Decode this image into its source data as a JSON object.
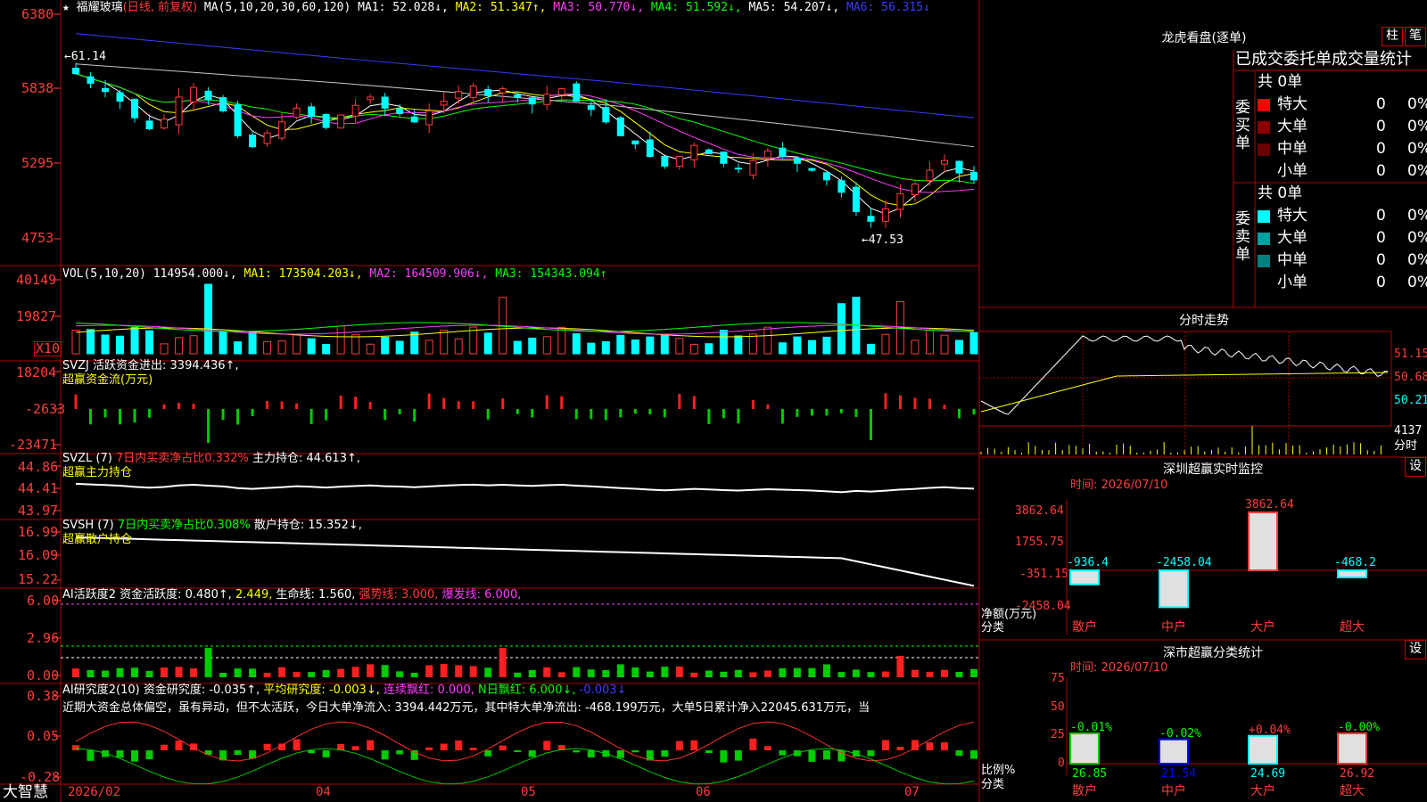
{
  "left_axis": {
    "price": [
      "6380",
      "5838",
      "5295",
      "4753"
    ],
    "vol": [
      "40149",
      "19827",
      "X10"
    ],
    "svzj": [
      "18204",
      "-2633",
      "-23471"
    ],
    "svzl": [
      "44.86",
      "44.41",
      "43.97"
    ],
    "svsh": [
      "16.99",
      "16.09",
      "15.22"
    ],
    "ai": [
      "6.00",
      "2.96",
      "0.00"
    ],
    "research": [
      "0.38",
      "0.05",
      "-0.28"
    ]
  },
  "header": {
    "stock_prefix": "★",
    "stock_name": "福耀玻璃",
    "period": "(日线, 前复权)",
    "ma_def": "MA(5,10,20,30,60,120)",
    "ma1": "MA1: 52.028↓,",
    "ma2": "MA2: 51.347↑,",
    "ma3": "MA3: 50.770↓,",
    "ma4": "MA4: 51.592↓,",
    "ma5": "MA5: 54.207↓,",
    "ma6": "MA6: 56.315↓"
  },
  "price_annotations": {
    "high": "←61.14",
    "low": "←47.53"
  },
  "vol_header": {
    "def": "VOL(5,10,20)",
    "val": "114954.000↓,",
    "ma1": "MA1: 173504.203↓,",
    "ma2": "MA2: 164509.906↓,",
    "ma3": "MA3: 154343.094↑"
  },
  "svzj_header": {
    "l1": "SVZJ  活跃资金进出: 3394.436↑,",
    "l2": "超赢资金流(万元)"
  },
  "svzl_header": {
    "a": "SVZL (7)",
    "b": "7日内买卖净占比0.332%",
    "c": "主力持仓: 44.613↑,",
    "l2": "超赢主力持仓"
  },
  "svsh_header": {
    "a": "SVSH (7)",
    "b": "7日内买卖净占比0.308%",
    "c": "散户持仓: 15.352↓,",
    "l2": "超赢散户持仓"
  },
  "ai_header": {
    "a": "AI活跃度2 资金活跃度: 0.480↑,",
    "b": "2.449,",
    "c": "生命线: 1.560,",
    "d": "强势线: 3.000,",
    "e": "爆发线: 6.000,"
  },
  "research_header": {
    "a": "AI研究度2(10) 资金研究度: -0.035↑,",
    "b": "平均研究度: -0.003↓,",
    "c": "连续飘红: 0.000,",
    "d": "N日飘红: 6.000↓,",
    "e": "-0.003↓"
  },
  "research_text": "近期大资金总体偏空，虽有异动，但不太活跃，今日大单净流入: 3394.442万元，其中特大单净流出: -468.199万元，大单5日累计净入22045.631万元，当",
  "date_axis": {
    "logo": "大智慧",
    "labels": [
      "2026/02",
      "04",
      "05",
      "06",
      "07"
    ]
  },
  "longhu": {
    "title": "龙虎看盘(逐单)",
    "btn1": "柱",
    "btn2": "笔",
    "header": "已成交委托单成交量统计",
    "buy_label": "委买单",
    "sell_label": "委卖单",
    "buy_total": "共 0单",
    "sell_total": "共 0单",
    "buy_rows": [
      {
        "name": "特大",
        "count": "0",
        "pct": "0%",
        "color": "#ff0000"
      },
      {
        "name": "大单",
        "count": "0",
        "pct": "0%",
        "color": "#8b0000"
      },
      {
        "name": "中单",
        "count": "0",
        "pct": "0%",
        "color": "#6b0000"
      },
      {
        "name": "小单",
        "count": "0",
        "pct": "0%",
        "color": "#000000"
      }
    ],
    "sell_rows": [
      {
        "name": "特大",
        "count": "0",
        "pct": "0%",
        "color": "#00ffff"
      },
      {
        "name": "大单",
        "count": "0",
        "pct": "0%",
        "color": "#00a0a0"
      },
      {
        "name": "中单",
        "count": "0",
        "pct": "0%",
        "color": "#008080"
      },
      {
        "name": "小单",
        "count": "0",
        "pct": "0%",
        "color": "#000000"
      }
    ]
  },
  "intraday": {
    "title": "分时走势",
    "prices": [
      "51.15",
      "50.68",
      "50.21"
    ],
    "vol_max": "4137",
    "vol_label": "分时"
  },
  "monitor": {
    "title": "深圳超赢实时监控",
    "btn": "设",
    "time": "时间: 2026/07/10",
    "y_labels": [
      "3862.64",
      "1755.75",
      "-351.15",
      "-2458.04"
    ],
    "ylabel": "净额(万元)",
    "xlabel": "分类",
    "categories": [
      "散户",
      "中户",
      "大户",
      "超大"
    ],
    "values": [
      -936.4,
      -2458.04,
      3862.64,
      -468.2
    ],
    "value_labels": [
      "-936.4",
      "-2458.04",
      "3862.64",
      "-468.2"
    ]
  },
  "stats": {
    "title": "深市超赢分类统计",
    "btn": "设",
    "time": "时间: 2026/07/10",
    "y_labels": [
      "75",
      "50",
      "25",
      "0"
    ],
    "ylabel": "比例%",
    "xlabel": "分类",
    "categories": [
      "散户",
      "中户",
      "大户",
      "超大"
    ],
    "values": [
      26.85,
      21.54,
      24.69,
      26.92
    ],
    "changes": [
      "-0.01%",
      "-0.02%",
      "+0.04%",
      "-0.00%"
    ],
    "value_labels": [
      "26.85",
      "21.54",
      "24.69",
      "26.92"
    ]
  },
  "chart_data": {
    "type": "candlestick",
    "title": "福耀玻璃 (日线, 前复权)",
    "x_labels": [
      "2026/02",
      "04",
      "05",
      "06",
      "07"
    ],
    "price_axis_ticks": [
      6380,
      5838,
      5295,
      4753
    ],
    "annotations": {
      "high": 61.14,
      "low": 47.53
    },
    "close_path": [
      59.5,
      58.8,
      58.2,
      57.5,
      56.3,
      55.5,
      56.2,
      57.8,
      58.5,
      57.6,
      56.8,
      55.0,
      54.2,
      55.2,
      56.0,
      57.0,
      56.4,
      55.6,
      56.5,
      57.2,
      57.8,
      57.0,
      56.6,
      56.0,
      56.8,
      57.5,
      58.2,
      58.6,
      57.9,
      58.4,
      57.8,
      57.3,
      58.0,
      58.4,
      57.5,
      56.9,
      56.0,
      55.0,
      54.4,
      53.5,
      52.8,
      53.5,
      54.3,
      53.7,
      53.0,
      52.6,
      53.2,
      53.9,
      53.5,
      53.0,
      52.5,
      51.8,
      50.9,
      49.5,
      48.8,
      49.7,
      50.8,
      51.5,
      52.5,
      53.2,
      52.3,
      51.8
    ],
    "moving_averages": {
      "MA1": "52.028",
      "MA2": "51.347",
      "MA3": "50.770",
      "MA4": "51.592",
      "MA5": "54.207",
      "MA6": "56.315"
    },
    "volume_axis_ticks": [
      40149,
      19827
    ],
    "fund_flow_axis_ticks": [
      18204,
      -2633,
      -23471
    ]
  }
}
